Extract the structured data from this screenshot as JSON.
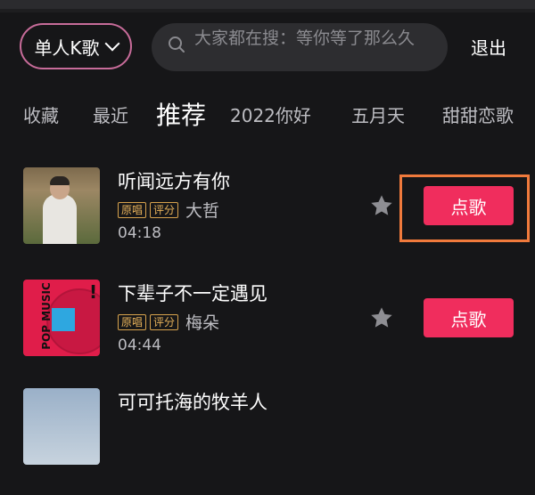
{
  "header": {
    "mode_label": "单人K歌",
    "search_placeholder": "大家都在搜：等你等了那么久",
    "exit_label": "退出"
  },
  "tabs": [
    {
      "label": "收藏",
      "active": false
    },
    {
      "label": "最近",
      "active": false
    },
    {
      "label": "推荐",
      "active": true
    },
    {
      "label": "2022你好",
      "active": false
    },
    {
      "label": "五月天",
      "active": false
    },
    {
      "label": "甜甜恋歌",
      "active": false
    }
  ],
  "songs": [
    {
      "title": "听闻远方有你",
      "badges": [
        "原唱",
        "评分"
      ],
      "artist": "大哲",
      "duration": "04:18",
      "button": "点歌",
      "highlighted": true
    },
    {
      "title": "下辈子不一定遇见",
      "badges": [
        "原唱",
        "评分"
      ],
      "artist": "梅朵",
      "duration": "04:44",
      "button": "点歌",
      "highlighted": false
    },
    {
      "title": "可可托海的牧羊人"
    }
  ],
  "album_art_text": {
    "song2_cover": "POP MUSIC"
  },
  "colors": {
    "accent": "#f02d5d",
    "highlight_box": "#f07a3c",
    "badge": "#d7a24d",
    "background": "#161618"
  }
}
